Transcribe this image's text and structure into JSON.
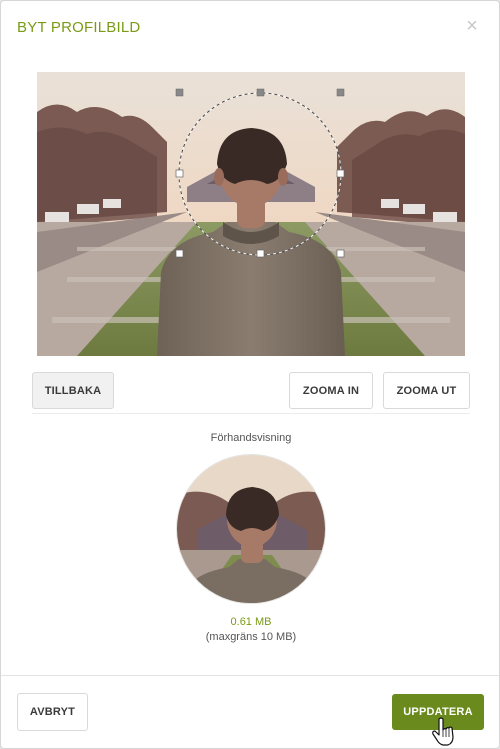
{
  "dialog": {
    "title": "BYT PROFILBILD",
    "close_glyph": "×"
  },
  "editor": {
    "image_subject": "man-back-view-park"
  },
  "controls": {
    "back_label": "TILLBAKA",
    "zoom_in_label": "ZOOMA IN",
    "zoom_out_label": "ZOOMA UT"
  },
  "preview": {
    "label": "Förhandsvisning",
    "file_size": "0.61 MB",
    "size_limit": "(maxgräns 10 MB)"
  },
  "footer": {
    "cancel_label": "AVBRYT",
    "update_label": "UPPDATERA"
  },
  "colors": {
    "accent": "#7a9b16",
    "primary_button": "#6a8a1d",
    "close_icon": "#c8c8c8"
  },
  "icons": [
    "close-icon",
    "crop-handle-icon",
    "hand-pointer-icon"
  ]
}
